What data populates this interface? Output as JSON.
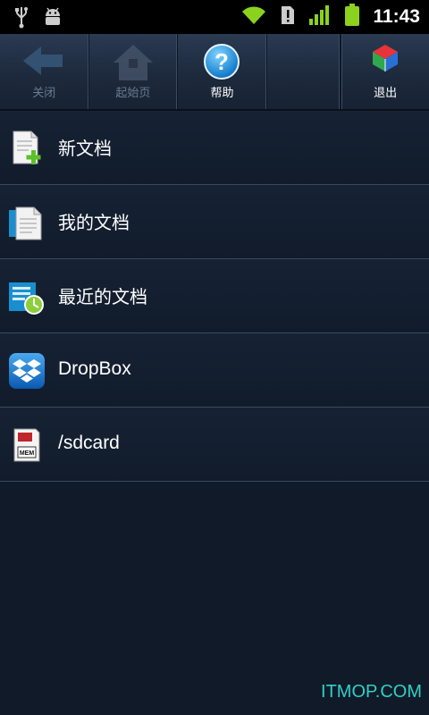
{
  "status_bar": {
    "time": "11:43",
    "icons": [
      "usb-icon",
      "android-debug-icon",
      "wifi-icon",
      "sim-alert-icon",
      "signal-icon",
      "battery-icon"
    ]
  },
  "toolbar": {
    "close_label": "关闭",
    "home_label": "起始页",
    "help_label": "帮助",
    "exit_label": "退出"
  },
  "list": {
    "items": [
      {
        "label": "新文档",
        "icon": "new-document-icon"
      },
      {
        "label": "我的文档",
        "icon": "my-documents-icon"
      },
      {
        "label": "最近的文档",
        "icon": "recent-documents-icon"
      },
      {
        "label": "DropBox",
        "icon": "dropbox-icon"
      },
      {
        "label": "/sdcard",
        "icon": "sdcard-icon"
      }
    ]
  },
  "watermark": "ITMOP.COM",
  "colors": {
    "background": "#111a28",
    "toolbar": "#1d2a3d",
    "accent_green": "#8bd21e",
    "watermark": "#2fd0c8"
  }
}
